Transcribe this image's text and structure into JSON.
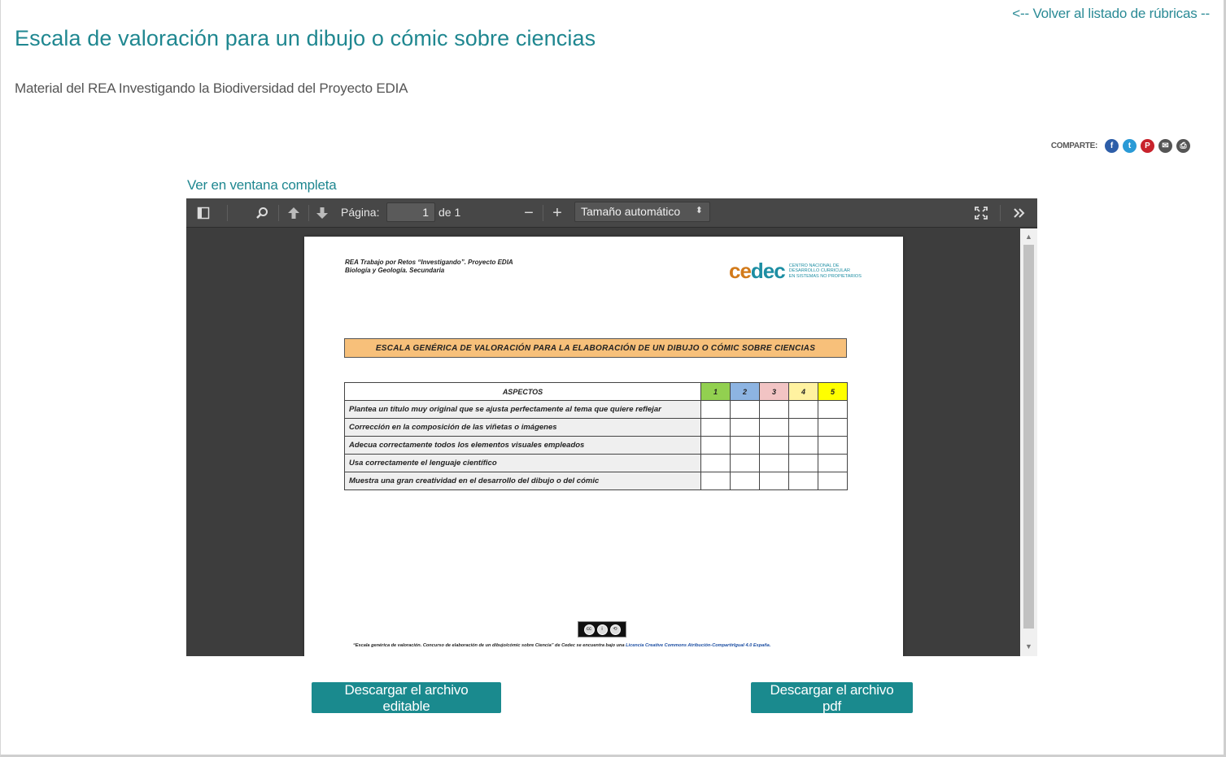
{
  "nav": {
    "back_link": "<-- Volver al listado de rúbricas --"
  },
  "header": {
    "title": "Escala de valoración para un dibujo o cómic sobre ciencias",
    "subtitle": "Material del REA Investigando la Biodiversidad del Proyecto EDIA"
  },
  "share": {
    "label": "COMPARTE:",
    "icons": [
      "facebook-icon",
      "twitter-icon",
      "pinterest-icon",
      "mail-icon",
      "print-icon"
    ]
  },
  "fullscreen_link": "Ver en ventana completa",
  "viewer": {
    "page_label": "Página:",
    "page_value": "1",
    "page_total": "de 1",
    "zoom_value": "Tamaño automático"
  },
  "document": {
    "header_line1": "REA Trabajo por Retos “Investigando”. Proyecto EDIA",
    "header_line2": "Biología y Geología. Secundaria",
    "logo_ce": "ce",
    "logo_dec": "dec",
    "logo_l1": "CENTRO NACIONAL DE",
    "logo_l2": "DESARROLLO CURRICULAR",
    "logo_l3": "EN SISTEMAS NO PROPIETARIOS",
    "banner": "ESCALA GENÉRICA DE VALORACIÓN PARA LA ELABORACIÓN DE UN DIBUJO O CÓMIC SOBRE CIENCIAS",
    "table": {
      "header": "ASPECTOS",
      "scores": [
        "1",
        "2",
        "3",
        "4",
        "5"
      ],
      "rows": [
        "Plantea un título muy original que  se ajusta perfectamente al tema que quiere reflejar",
        "Corrección en la composición de las viñetas o imágenes",
        "Adecua correctamente todos los elementos visuales empleados",
        "Usa correctamente el lenguaje científico",
        "Muestra una gran creatividad en el desarrollo del dibujo o del cómic"
      ]
    },
    "footnote_text": "“Escala genérica de valoración. Concurso de elaboración de un dibujo/cómic  sobre Ciencia” de Cedec se encuentra bajo una ",
    "footnote_license": "Licencia Creative Commons Atribución-CompartirIgual 4.0 España."
  },
  "buttons": {
    "editable": "Descargar el archivo editable",
    "pdf": "Descargar el archivo pdf"
  },
  "colors": {
    "accent": "#1f8790",
    "button": "#1a8a8e",
    "banner": "#f7c07a"
  }
}
